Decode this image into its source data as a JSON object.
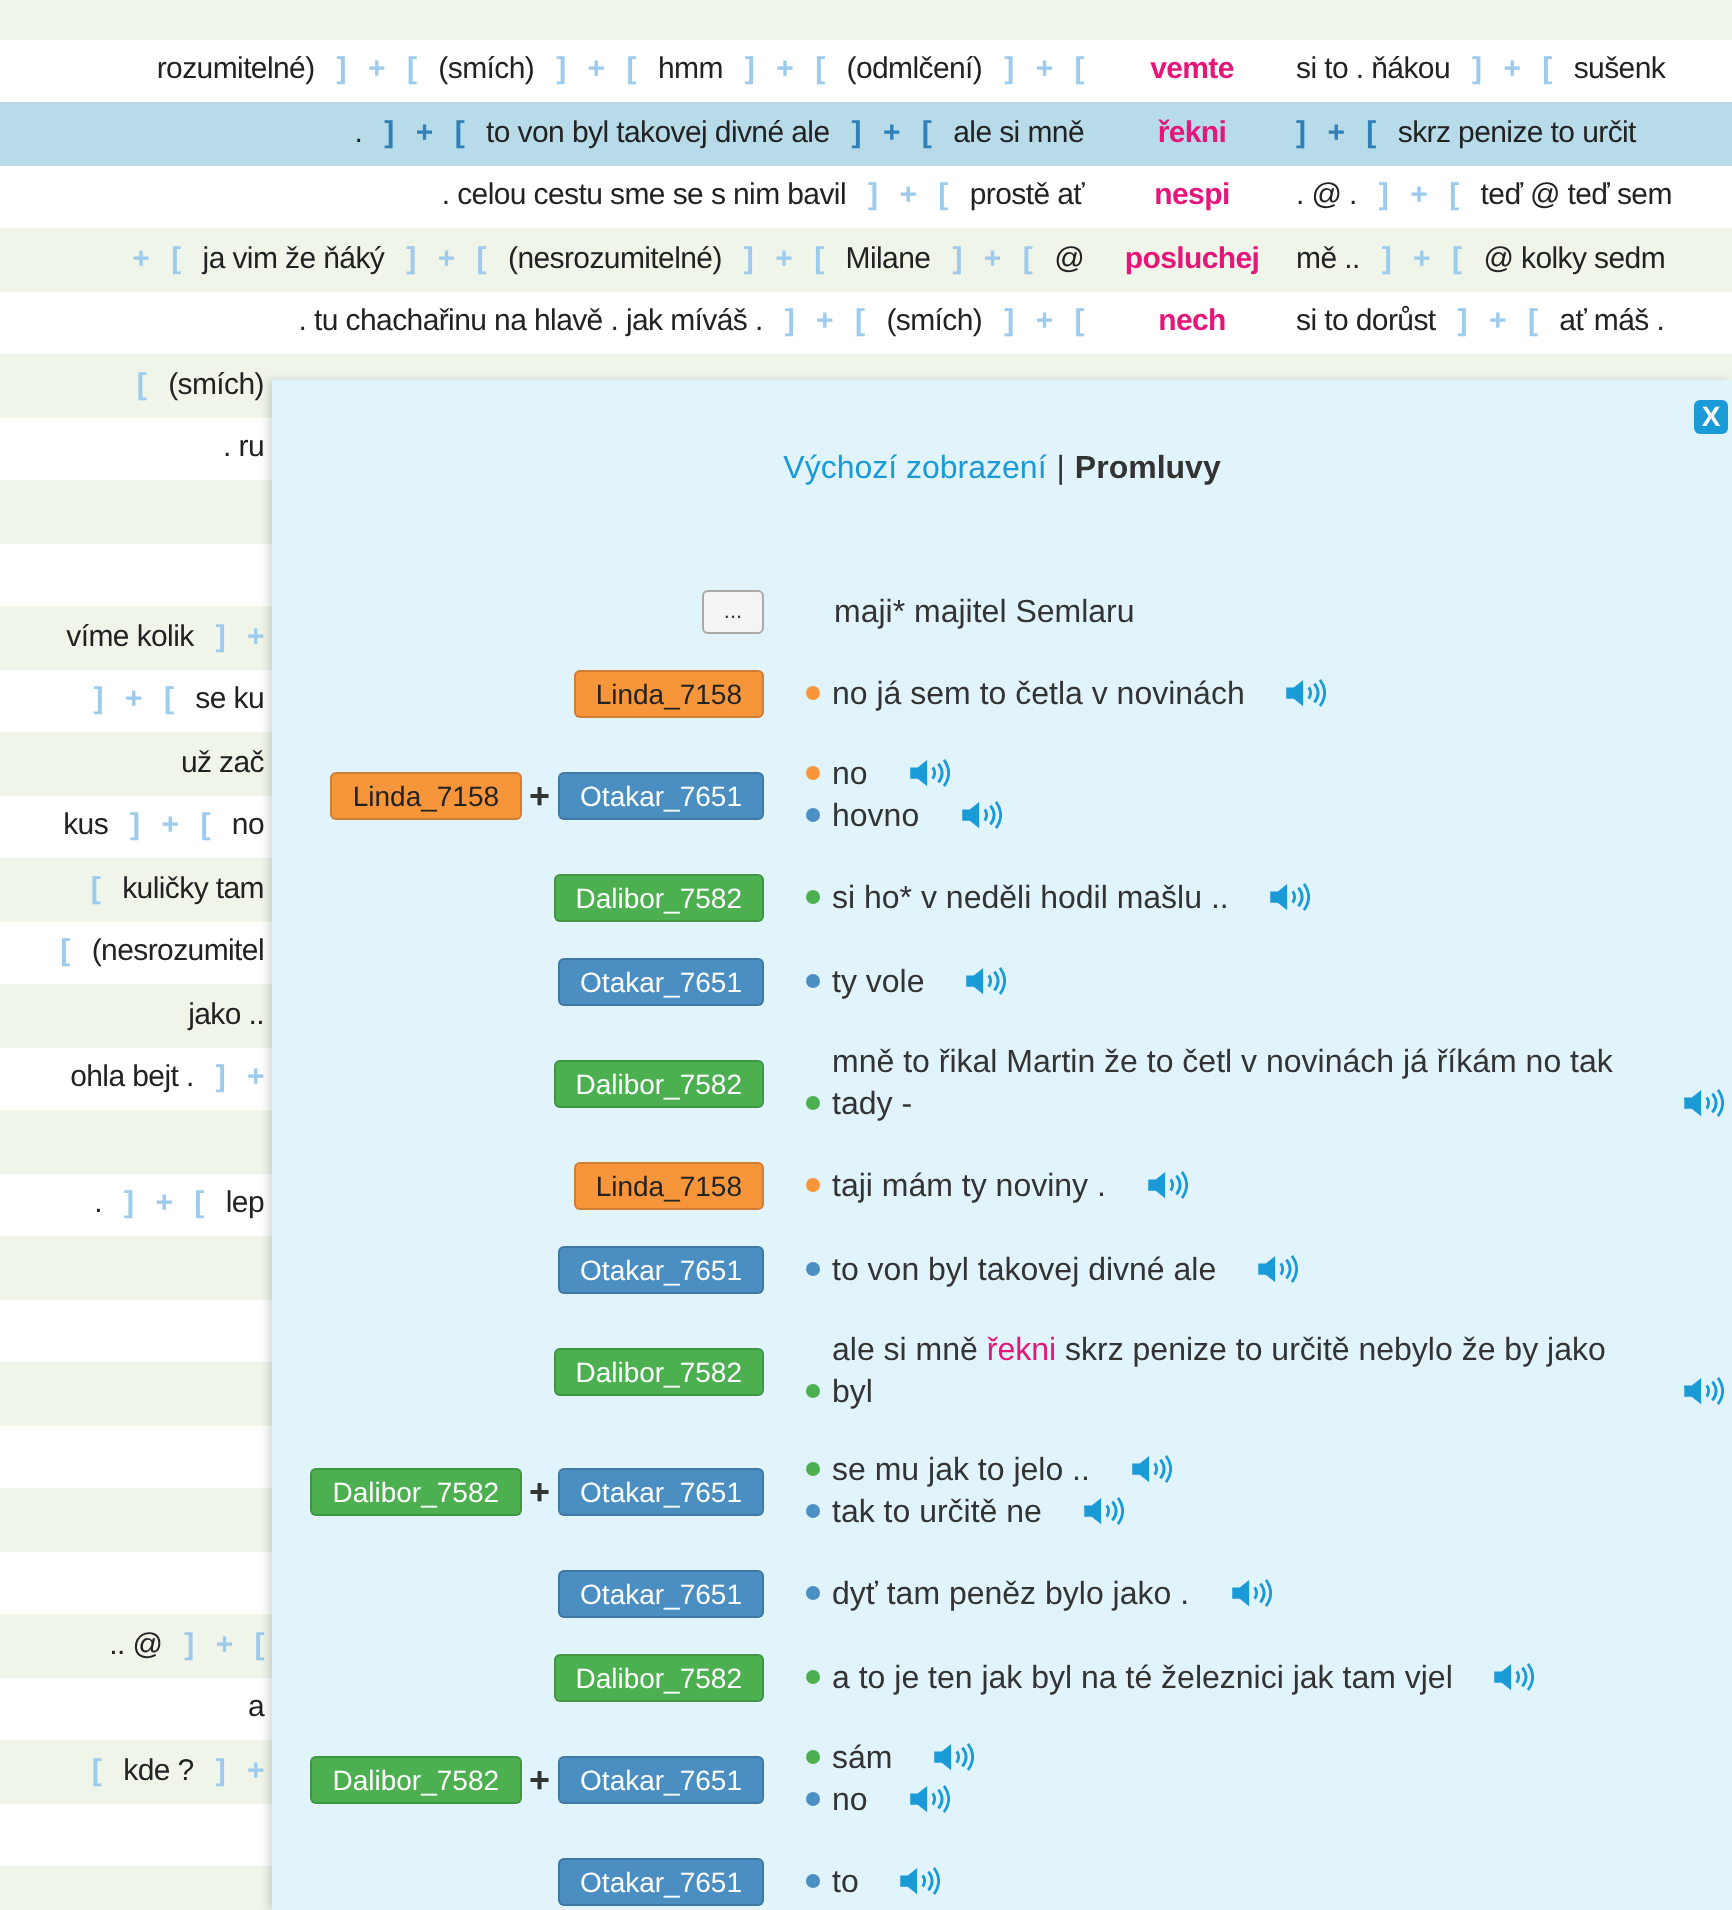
{
  "concordance": {
    "rows": [
      {
        "selected": false
      },
      {
        "selected": false,
        "left": [
          {
            "kind": "word",
            "text": "rozumitelné)"
          },
          {
            "kind": "close",
            "text": "]"
          },
          {
            "kind": "plus",
            "text": "+"
          },
          {
            "kind": "open",
            "text": "["
          },
          {
            "kind": "word",
            "text": "(smích)"
          },
          {
            "kind": "close",
            "text": "]"
          },
          {
            "kind": "plus",
            "text": "+"
          },
          {
            "kind": "open",
            "text": "["
          },
          {
            "kind": "word",
            "text": "hmm"
          },
          {
            "kind": "close",
            "text": "]"
          },
          {
            "kind": "plus",
            "text": "+"
          },
          {
            "kind": "open",
            "text": "["
          },
          {
            "kind": "word",
            "text": "(odmlčení)"
          },
          {
            "kind": "close",
            "text": "]"
          },
          {
            "kind": "plus",
            "text": "+"
          },
          {
            "kind": "open",
            "text": "["
          }
        ],
        "keyword": "vemte",
        "right": [
          {
            "kind": "word",
            "text": "si to . ňákou"
          },
          {
            "kind": "close",
            "text": "]"
          },
          {
            "kind": "plus",
            "text": "+"
          },
          {
            "kind": "open",
            "text": "["
          },
          {
            "kind": "word",
            "text": "sušenk"
          }
        ]
      },
      {
        "selected": true,
        "left": [
          {
            "kind": "word",
            "text": "."
          },
          {
            "kind": "close",
            "text": "]"
          },
          {
            "kind": "plus",
            "text": "+"
          },
          {
            "kind": "open",
            "text": "["
          },
          {
            "kind": "word",
            "text": "to von byl takovej divné ale"
          },
          {
            "kind": "close",
            "text": "]"
          },
          {
            "kind": "plus",
            "text": "+"
          },
          {
            "kind": "open",
            "text": "["
          },
          {
            "kind": "word",
            "text": "ale si mně"
          }
        ],
        "keyword": "řekni",
        "right": [
          {
            "kind": "close",
            "text": "]"
          },
          {
            "kind": "plus",
            "text": "+"
          },
          {
            "kind": "open",
            "text": "["
          },
          {
            "kind": "word",
            "text": "skrz penize to určit"
          }
        ]
      },
      {
        "selected": false,
        "left": [
          {
            "kind": "word",
            "text": ". celou cestu sme se s nim bavil"
          },
          {
            "kind": "close",
            "text": "]"
          },
          {
            "kind": "plus",
            "text": "+"
          },
          {
            "kind": "open",
            "text": "["
          },
          {
            "kind": "word",
            "text": "prostě ať"
          }
        ],
        "keyword": "nespi",
        "right": [
          {
            "kind": "word",
            "text": ". @ ."
          },
          {
            "kind": "close",
            "text": "]"
          },
          {
            "kind": "plus",
            "text": "+"
          },
          {
            "kind": "open",
            "text": "["
          },
          {
            "kind": "word",
            "text": "teď @ teď sem"
          }
        ]
      },
      {
        "selected": false,
        "left": [
          {
            "kind": "plus",
            "text": "+"
          },
          {
            "kind": "open",
            "text": "["
          },
          {
            "kind": "word",
            "text": "ja vim že ňáký"
          },
          {
            "kind": "close",
            "text": "]"
          },
          {
            "kind": "plus",
            "text": "+"
          },
          {
            "kind": "open",
            "text": "["
          },
          {
            "kind": "word",
            "text": "(nesrozumitelné)"
          },
          {
            "kind": "close",
            "text": "]"
          },
          {
            "kind": "plus",
            "text": "+"
          },
          {
            "kind": "open",
            "text": "["
          },
          {
            "kind": "word",
            "text": "Milane"
          },
          {
            "kind": "close",
            "text": "]"
          },
          {
            "kind": "plus",
            "text": "+"
          },
          {
            "kind": "open",
            "text": "["
          },
          {
            "kind": "word",
            "text": "@"
          }
        ],
        "keyword": "posluchej",
        "right": [
          {
            "kind": "word",
            "text": "mě .."
          },
          {
            "kind": "close",
            "text": "]"
          },
          {
            "kind": "plus",
            "text": "+"
          },
          {
            "kind": "open",
            "text": "["
          },
          {
            "kind": "word",
            "text": "@ kolky sedm"
          }
        ]
      },
      {
        "selected": false,
        "left": [
          {
            "kind": "word",
            "text": ". tu chachařinu na hlavě . jak míváš ."
          },
          {
            "kind": "close",
            "text": "]"
          },
          {
            "kind": "plus",
            "text": "+"
          },
          {
            "kind": "open",
            "text": "["
          },
          {
            "kind": "word",
            "text": "(smích)"
          },
          {
            "kind": "close",
            "text": "]"
          },
          {
            "kind": "plus",
            "text": "+"
          },
          {
            "kind": "open",
            "text": "["
          }
        ],
        "keyword": "nech",
        "right": [
          {
            "kind": "word",
            "text": "si to dorůst"
          },
          {
            "kind": "close",
            "text": "]"
          },
          {
            "kind": "plus",
            "text": "+"
          },
          {
            "kind": "open",
            "text": "["
          },
          {
            "kind": "word",
            "text": "ať máš ."
          }
        ]
      },
      {
        "selected": false,
        "left": [
          {
            "kind": "open",
            "text": "["
          },
          {
            "kind": "word",
            "text": "(smích)"
          }
        ]
      },
      {
        "selected": false,
        "left": [
          {
            "kind": "word",
            "text": ". ru"
          }
        ]
      },
      {
        "selected": false
      },
      {
        "selected": false
      },
      {
        "selected": false,
        "left": [
          {
            "kind": "word",
            "text": "víme kolik"
          },
          {
            "kind": "close",
            "text": "]"
          },
          {
            "kind": "plus",
            "text": "+"
          }
        ]
      },
      {
        "selected": false,
        "left": [
          {
            "kind": "close",
            "text": "]"
          },
          {
            "kind": "plus",
            "text": "+"
          },
          {
            "kind": "open",
            "text": "["
          },
          {
            "kind": "word",
            "text": "se ku"
          }
        ]
      },
      {
        "selected": false,
        "left": [
          {
            "kind": "word",
            "text": "už zač"
          }
        ]
      },
      {
        "selected": false,
        "left": [
          {
            "kind": "word",
            "text": "kus"
          },
          {
            "kind": "close",
            "text": "]"
          },
          {
            "kind": "plus",
            "text": "+"
          },
          {
            "kind": "open",
            "text": "["
          },
          {
            "kind": "word",
            "text": "no"
          }
        ]
      },
      {
        "selected": false,
        "left": [
          {
            "kind": "open",
            "text": "["
          },
          {
            "kind": "word",
            "text": "kuličky tam"
          }
        ]
      },
      {
        "selected": false,
        "left": [
          {
            "kind": "open",
            "text": "["
          },
          {
            "kind": "word",
            "text": "(nesrozumitel"
          }
        ]
      },
      {
        "selected": false,
        "left": [
          {
            "kind": "word",
            "text": "jako .."
          }
        ]
      },
      {
        "selected": false,
        "left": [
          {
            "kind": "word",
            "text": "ohla bejt ."
          },
          {
            "kind": "close",
            "text": "]"
          },
          {
            "kind": "plus",
            "text": "+"
          }
        ]
      },
      {
        "selected": false
      },
      {
        "selected": false,
        "left": [
          {
            "kind": "word",
            "text": "."
          },
          {
            "kind": "close",
            "text": "]"
          },
          {
            "kind": "plus",
            "text": "+"
          },
          {
            "kind": "open",
            "text": "["
          },
          {
            "kind": "word",
            "text": "lep"
          }
        ]
      },
      {
        "selected": false
      },
      {
        "selected": false
      },
      {
        "selected": false
      },
      {
        "selected": false
      },
      {
        "selected": false
      },
      {
        "selected": false
      },
      {
        "selected": false,
        "left": [
          {
            "kind": "word",
            "text": ".. @"
          },
          {
            "kind": "close",
            "text": "]"
          },
          {
            "kind": "plus",
            "text": "+"
          },
          {
            "kind": "open",
            "text": "["
          }
        ]
      },
      {
        "selected": false,
        "left": [
          {
            "kind": "word",
            "text": "a"
          }
        ]
      },
      {
        "selected": false,
        "left": [
          {
            "kind": "open",
            "text": "["
          },
          {
            "kind": "word",
            "text": "kde ?"
          },
          {
            "kind": "close",
            "text": "]"
          },
          {
            "kind": "plus",
            "text": "+"
          }
        ]
      },
      {
        "selected": false
      },
      {
        "selected": false
      }
    ]
  },
  "panel": {
    "close": "X",
    "tabs": [
      {
        "label": "Výchozí zobrazení",
        "selected": false
      },
      {
        "label": "Promluvy",
        "selected": true
      }
    ],
    "separator": "|",
    "utterances": [
      {
        "more": "...",
        "lines": [
          {
            "text": "maji* majitel Semlaru"
          }
        ]
      },
      {
        "speakers": [
          {
            "name": "Linda_7158",
            "color": "#f7953b"
          }
        ],
        "lines": [
          {
            "color": "#f7953b",
            "text": "no já sem to četla v novinách"
          }
        ]
      },
      {
        "speakers": [
          {
            "name": "Linda_7158",
            "color": "#f7953b"
          },
          {
            "name": "Otakar_7651",
            "color": "#4a8ec2"
          }
        ],
        "joiner": "+",
        "lines": [
          {
            "color": "#f7953b",
            "text": "no"
          },
          {
            "color": "#4a8ec2",
            "text": "hovno"
          }
        ]
      },
      {
        "speakers": [
          {
            "name": "Dalibor_7582",
            "color": "#4cb050"
          }
        ],
        "lines": [
          {
            "color": "#4cb050",
            "text": "si ho* v neděli hodil mašlu .."
          }
        ]
      },
      {
        "speakers": [
          {
            "name": "Otakar_7651",
            "color": "#4a8ec2"
          }
        ],
        "lines": [
          {
            "color": "#4a8ec2",
            "text": "ty vole"
          }
        ]
      },
      {
        "speakers": [
          {
            "name": "Dalibor_7582",
            "color": "#4cb050"
          }
        ],
        "lines": [
          {
            "color": "#4cb050",
            "text": "mně to řikal Martin že to četl v novinách já říkám no tak tady -"
          }
        ]
      },
      {
        "speakers": [
          {
            "name": "Linda_7158",
            "color": "#f7953b"
          }
        ],
        "lines": [
          {
            "color": "#f7953b",
            "text": "taji mám ty noviny ."
          }
        ]
      },
      {
        "speakers": [
          {
            "name": "Otakar_7651",
            "color": "#4a8ec2"
          }
        ],
        "lines": [
          {
            "color": "#4a8ec2",
            "text": "to von byl takovej divné ale"
          }
        ]
      },
      {
        "speakers": [
          {
            "name": "Dalibor_7582",
            "color": "#4cb050"
          }
        ],
        "lines": [
          {
            "color": "#4cb050",
            "text": "ale si mně",
            "keyword": "řekni",
            "text_after": "skrz penize to určitě nebylo že by jako byl"
          }
        ]
      },
      {
        "speakers": [
          {
            "name": "Dalibor_7582",
            "color": "#4cb050"
          },
          {
            "name": "Otakar_7651",
            "color": "#4a8ec2"
          }
        ],
        "joiner": "+",
        "lines": [
          {
            "color": "#4cb050",
            "text": "se mu jak to jelo .."
          },
          {
            "color": "#4a8ec2",
            "text": "tak to určitě ne"
          }
        ]
      },
      {
        "speakers": [
          {
            "name": "Otakar_7651",
            "color": "#4a8ec2"
          }
        ],
        "lines": [
          {
            "color": "#4a8ec2",
            "text": "dyť tam peněz bylo jako ."
          }
        ]
      },
      {
        "speakers": [
          {
            "name": "Dalibor_7582",
            "color": "#4cb050"
          }
        ],
        "lines": [
          {
            "color": "#4cb050",
            "text": "a to je ten jak byl na té železnici jak tam vjel"
          }
        ]
      },
      {
        "speakers": [
          {
            "name": "Dalibor_7582",
            "color": "#4cb050"
          },
          {
            "name": "Otakar_7651",
            "color": "#4a8ec2"
          }
        ],
        "joiner": "+",
        "lines": [
          {
            "color": "#4cb050",
            "text": "sám"
          },
          {
            "color": "#4a8ec2",
            "text": "no"
          }
        ]
      },
      {
        "speakers": [
          {
            "name": "Otakar_7651",
            "color": "#4a8ec2"
          }
        ],
        "lines": [
          {
            "color": "#4a8ec2",
            "text": "to"
          }
        ]
      }
    ]
  }
}
